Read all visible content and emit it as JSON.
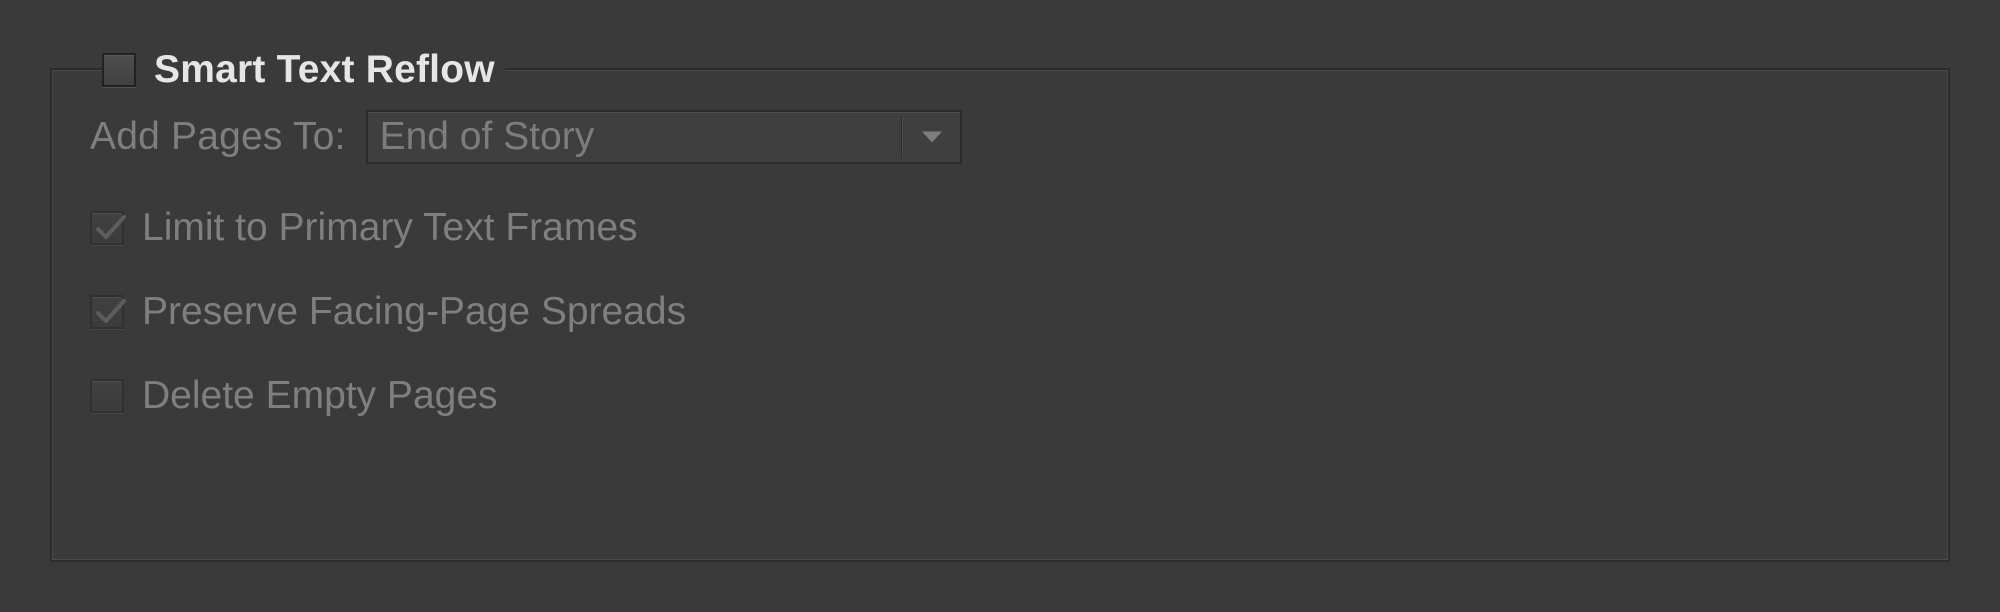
{
  "group": {
    "title": "Smart Text Reflow",
    "enabled": false
  },
  "addPages": {
    "label": "Add Pages To:",
    "value": "End of Story"
  },
  "options": {
    "limitPrimary": {
      "label": "Limit to Primary Text Frames",
      "checked": true
    },
    "preserveSpreads": {
      "label": "Preserve Facing-Page Spreads",
      "checked": true
    },
    "deleteEmpty": {
      "label": "Delete Empty Pages",
      "checked": false
    }
  }
}
